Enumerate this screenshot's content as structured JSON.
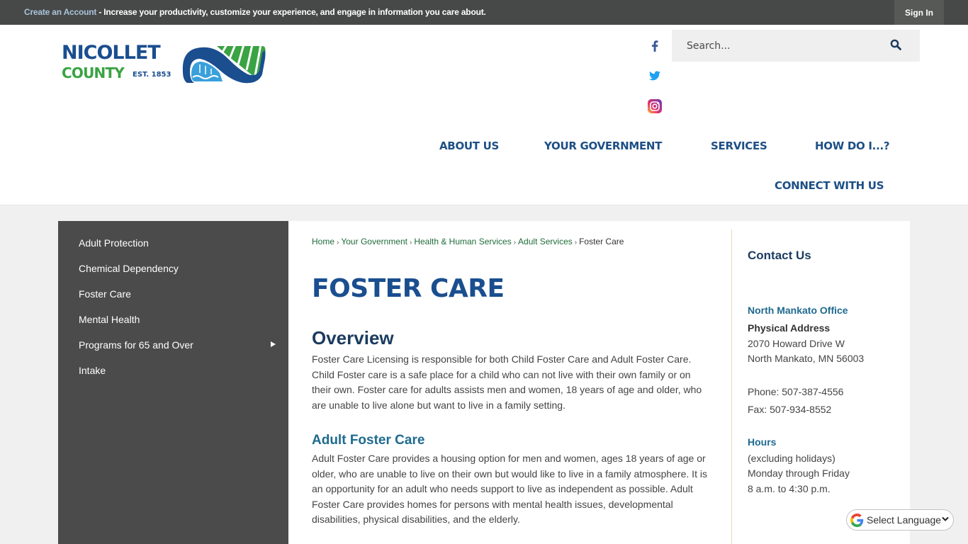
{
  "topbar": {
    "create_account_link": "Create an Account",
    "message": " - Increase your productivity, customize your experience, and engage in information you care about.",
    "sign_in": "Sign In"
  },
  "logo": {
    "line1": "NICOLLET",
    "line2": "COUNTY",
    "est": "EST. 1853"
  },
  "social": {
    "items": [
      {
        "name": "facebook-icon",
        "color": "#3b5998"
      },
      {
        "name": "twitter-icon",
        "color": "#1da1f2"
      },
      {
        "name": "instagram-icon",
        "color": "#c13584"
      }
    ]
  },
  "search": {
    "placeholder": "Search..."
  },
  "nav": {
    "items": [
      {
        "label": "ABOUT US"
      },
      {
        "label": "YOUR GOVERNMENT"
      },
      {
        "label": "SERVICES"
      },
      {
        "label": "HOW DO I...?"
      },
      {
        "label": "CONNECT WITH US"
      }
    ]
  },
  "sidebar": {
    "items": [
      {
        "label": "Adult Protection"
      },
      {
        "label": "Chemical Dependency"
      },
      {
        "label": "Foster Care"
      },
      {
        "label": "Mental Health"
      },
      {
        "label": "Programs for 65 and Over",
        "has_submenu": true
      },
      {
        "label": "Intake"
      }
    ]
  },
  "breadcrumb": {
    "items": [
      "Home",
      "Your Government",
      "Health & Human Services",
      "Adult Services"
    ],
    "current": "Foster Care",
    "separator": "›"
  },
  "page": {
    "title": "FOSTER CARE",
    "overview_heading": "Overview",
    "overview_text": "Foster Care Licensing is responsible for both Child Foster Care and Adult Foster Care. Child Foster care is a safe place for a child who can not live with their own family or on their own. Foster care for adults assists men and women, 18 years of age and older, who are unable to live alone but want to live in a family setting.",
    "adult_heading": "Adult Foster Care",
    "adult_text": "Adult Foster Care provides a housing option for men and women, ages 18 years of age or older, who are unable to live on their own but would like to live in a family atmosphere. It is an opportunity for an adult who needs support to live as independent as possible. Adult Foster Care provides homes for persons with mental health issues, developmental disabilities, physical disabilities, and the elderly."
  },
  "contact": {
    "title": "Contact Us",
    "office": "North Mankato Office",
    "address_label": "Physical Address",
    "address_line1": "2070 Howard Drive W",
    "address_line2": "North Mankato, MN 56003",
    "phone": "Phone: 507-387-4556",
    "fax": "Fax: 507-934-8552",
    "hours_label": "Hours",
    "hours_note": "(excluding holidays)",
    "hours_days": "Monday through Friday",
    "hours_time": "8 a.m. to 4:30 p.m."
  },
  "language": {
    "label": "Select Language"
  },
  "colors": {
    "brand_blue": "#1a4e8f",
    "brand_green": "#3aa343",
    "topbar": "#474948",
    "sidebar": "#4a4b4a",
    "link_green": "#1f6b39",
    "heading_teal": "#1f6a8f"
  }
}
